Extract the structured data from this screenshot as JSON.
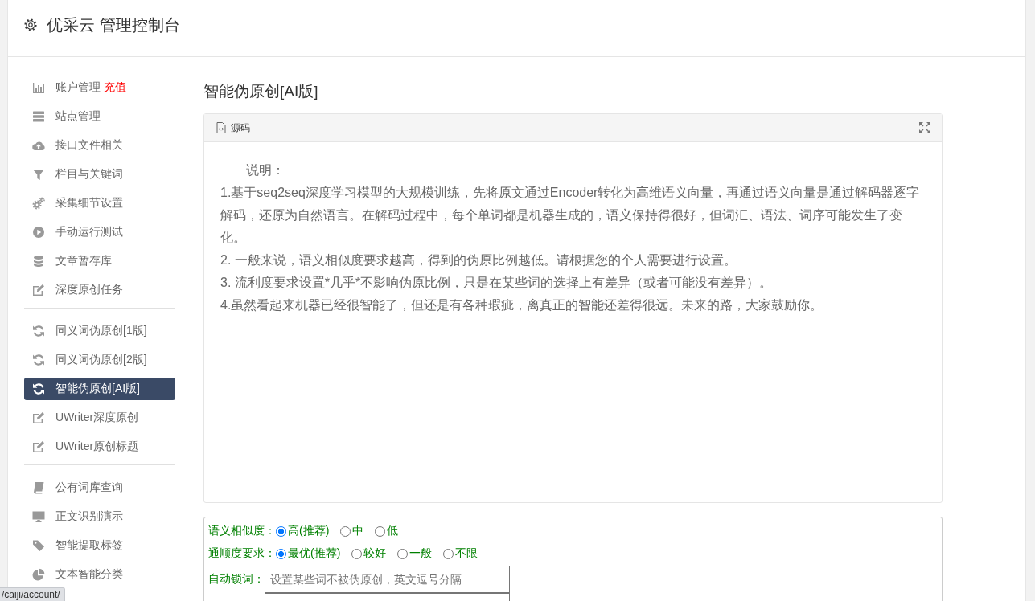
{
  "header": {
    "title": "优采云 管理控制台"
  },
  "sidebar": {
    "sections": [
      {
        "items": [
          {
            "label": "账户管理",
            "badge": "充值",
            "selected": false
          },
          {
            "label": "站点管理",
            "selected": false
          },
          {
            "label": "接口文件相关",
            "selected": false
          },
          {
            "label": "栏目与关键词",
            "selected": false
          },
          {
            "label": "采集细节设置",
            "selected": false
          },
          {
            "label": "手动运行测试",
            "selected": false
          },
          {
            "label": "文章暂存库",
            "selected": false
          },
          {
            "label": "深度原创任务",
            "selected": false
          }
        ]
      },
      {
        "items": [
          {
            "label": "同义词伪原创[1版]",
            "selected": false
          },
          {
            "label": "同义词伪原创[2版]",
            "selected": false
          },
          {
            "label": "智能伪原创[AI版]",
            "selected": true
          },
          {
            "label": "UWriter深度原创",
            "selected": false
          },
          {
            "label": "UWriter原创标题",
            "selected": false
          }
        ]
      },
      {
        "items": [
          {
            "label": "公有词库查询",
            "selected": false
          },
          {
            "label": "正文识别演示",
            "selected": false
          },
          {
            "label": "智能提取标签",
            "selected": false
          },
          {
            "label": "文本智能分类",
            "selected": false
          }
        ]
      }
    ]
  },
  "main": {
    "title": "智能伪原创[AI版]",
    "source_panel": {
      "title": "源码",
      "intro": "说明：",
      "paragraphs": [
        "1.基于seq2seq深度学习模型的大规模训练，先将原文通过Encoder转化为高维语义向量，再通过语义向量是通过解码器逐字解码，还原为自然语言。在解码过程中，每个单词都是机器生成的，语义保持得很好，但词汇、语法、词序可能发生了变化。",
        "2. 一般来说，语义相似度要求越高，得到的伪原比例越低。请根据您的个人需要进行设置。",
        "3. 流利度要求设置*几乎*不影响伪原比例，只是在某些词的选择上有差异（或者可能没有差异）。",
        "4.虽然看起来机器已经很智能了，但还是有各种瑕疵，离真正的智能还差得很远。未来的路，大家鼓励你。"
      ]
    },
    "options_form": {
      "rows": [
        {
          "kind": "radio",
          "label": "语义相似度：",
          "options": [
            {
              "label": "高(推荐)",
              "selected": true
            },
            {
              "label": "中",
              "selected": false
            },
            {
              "label": "低",
              "selected": false
            }
          ]
        },
        {
          "kind": "radio",
          "label": "通顺度要求：",
          "options": [
            {
              "label": "最优(推荐)",
              "selected": true
            },
            {
              "label": "较好",
              "selected": false
            },
            {
              "label": "一般",
              "selected": false
            },
            {
              "label": "不限",
              "selected": false
            }
          ]
        },
        {
          "kind": "text",
          "label": "自动锁词：",
          "placeholder": "设置某些词不被伪原创，英文逗号分隔"
        },
        {
          "kind": "textarea"
        }
      ]
    }
  },
  "status_bar": {
    "url": "/caiji/account/"
  }
}
